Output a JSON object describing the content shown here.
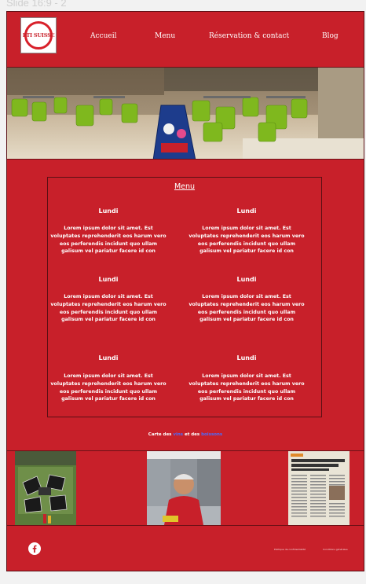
{
  "slide_label": "Slide 16:9 - 2",
  "brand": {
    "logo_text": "PTI SUISSE",
    "accent": "#c8202a"
  },
  "nav": [
    {
      "label": "Accueil"
    },
    {
      "label": "Menu"
    },
    {
      "label": "Réservation & contact"
    },
    {
      "label": "Blog"
    }
  ],
  "menu": {
    "title": "Menu",
    "entries": [
      {
        "day": "Lundi",
        "text": "Lorem ipsum dolor sit amet. Est voluptates reprehenderit eos harum vero eos perferendis incidunt quo ullam galisum vel pariatur facere id con"
      },
      {
        "day": "Lundi",
        "text": "Lorem ipsum dolor sit amet. Est voluptates reprehenderit eos harum vero eos perferendis incidunt quo ullam galisum vel pariatur facere id con"
      },
      {
        "day": "Lundi",
        "text": "Lorem ipsum dolor sit amet. Est voluptates reprehenderit eos harum vero eos perferendis incidunt quo ullam galisum vel pariatur facere id con"
      },
      {
        "day": "Lundi",
        "text": "Lorem ipsum dolor sit amet. Est voluptates reprehenderit eos harum vero eos perferendis incidunt quo ullam galisum vel pariatur facere id con"
      },
      {
        "day": "Lundi",
        "text": "Lorem ipsum dolor sit amet. Est voluptates reprehenderit eos harum vero eos perferendis incidunt quo ullam galisum vel pariatur facere id con"
      },
      {
        "day": "Lundi",
        "text": "Lorem ipsum dolor sit amet. Est voluptates reprehenderit eos harum vero eos perferendis incidunt quo ullam galisum vel pariatur facere id con"
      }
    ]
  },
  "carte": {
    "prefix": "Carte des ",
    "link1": "vins",
    "middle": " et des ",
    "link2": "boissons"
  },
  "footer": {
    "social_icon": "facebook-icon",
    "link1": "Politique de confidentialité",
    "link2": "Conditions générales"
  }
}
